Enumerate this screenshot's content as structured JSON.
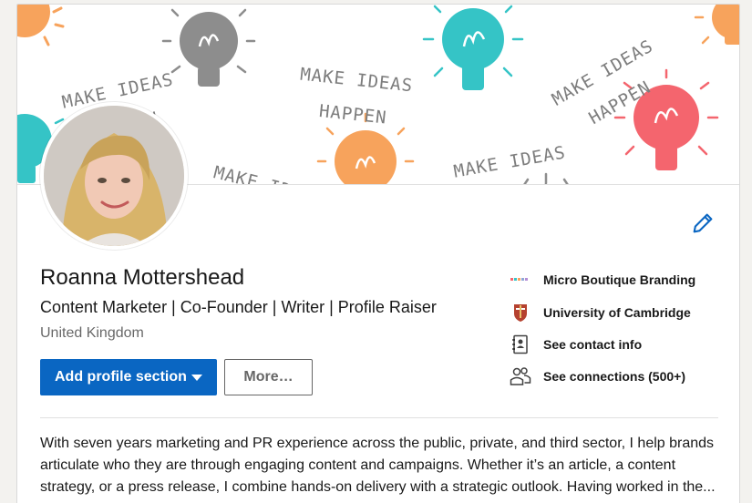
{
  "banner": {
    "slogan_lines": [
      "MAKE IDEAS",
      "HAPPEN"
    ]
  },
  "profile": {
    "name": "Roanna Mottershead",
    "headline": "Content Marketer | Co-Founder | Writer | Profile Raiser",
    "location": "United Kingdom",
    "avatar_icon": "profile-photo"
  },
  "actions": {
    "add_section_label": "Add profile section",
    "more_label": "More…",
    "edit_icon": "pencil-icon"
  },
  "sidebar": {
    "items": [
      {
        "label": "Micro Boutique Branding",
        "icon": "company-logo"
      },
      {
        "label": "University of Cambridge",
        "icon": "school-crest"
      },
      {
        "label": "See contact info",
        "icon": "contact-card-icon"
      },
      {
        "label": "See connections (500+)",
        "icon": "people-icon"
      }
    ]
  },
  "about": {
    "summary": "With seven years marketing and PR experience across the public, private, and third sector, I help brands articulate who they are through engaging content and campaigns. Whether it’s an article, a content strategy, or a press release, I combine hands-on delivery with a strategic outlook. Having worked in the..."
  },
  "colors": {
    "primary": "#0a66c2",
    "bulb_teal": "#35c4c6",
    "bulb_orange": "#f7a35c",
    "bulb_red": "#f4656e",
    "bulb_grey": "#8d8d8d"
  }
}
